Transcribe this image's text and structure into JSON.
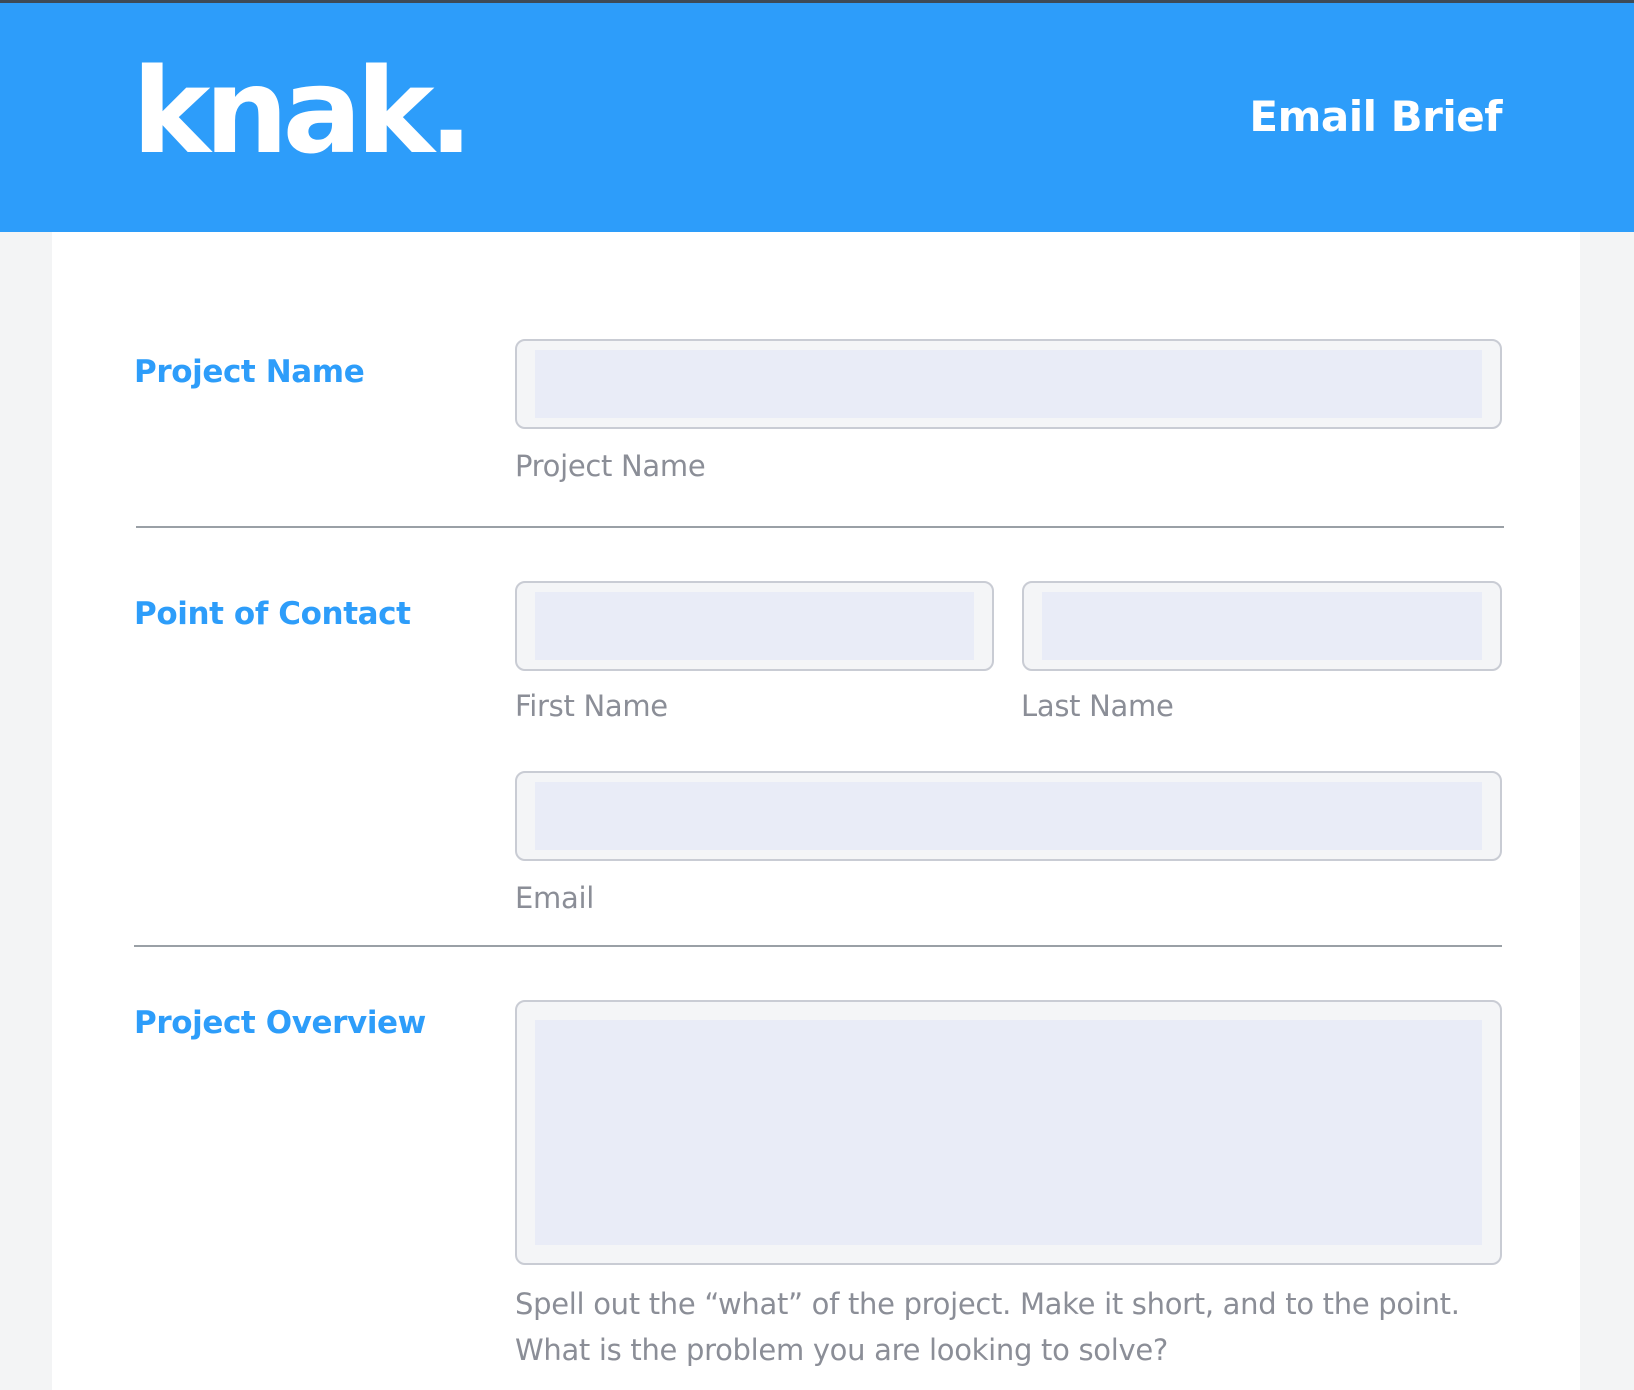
{
  "header": {
    "logo": "knak.",
    "title": "Email Brief"
  },
  "sections": {
    "project_name": {
      "label": "Project Name",
      "field_caption": "Project Name",
      "value": ""
    },
    "point_of_contact": {
      "label": "Point of Contact",
      "first_name_caption": "First Name",
      "last_name_caption": "Last Name",
      "email_caption": "Email",
      "first_name_value": "",
      "last_name_value": "",
      "email_value": ""
    },
    "project_overview": {
      "label": "Project Overview",
      "caption": "Spell out the “what” of the project. Make it short, and to the point. What is the problem you are looking to solve?",
      "value": ""
    }
  },
  "colors": {
    "brand": "#2d9dfa",
    "input_fill": "#e9ecf7",
    "caption": "#8b8e97"
  }
}
